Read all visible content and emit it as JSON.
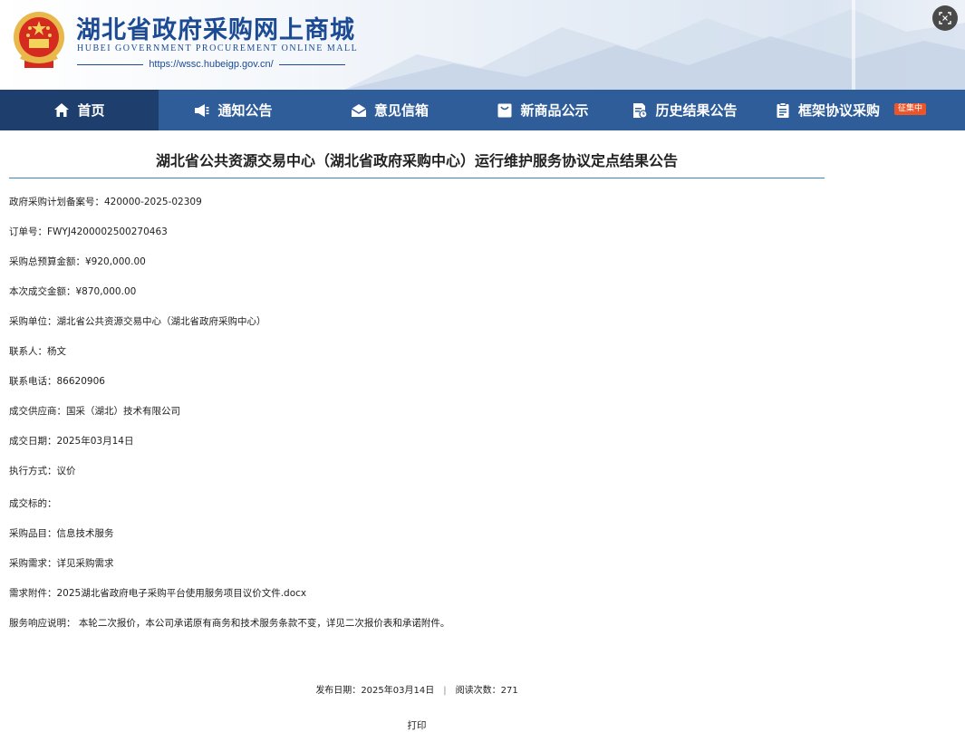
{
  "header": {
    "site_title": "湖北省政府采购网上商城",
    "site_subtitle": "HUBEI GOVERNMENT PROCUREMENT ONLINE MALL",
    "site_url": "https://wssc.hubeigp.gov.cn/"
  },
  "nav": {
    "items": [
      {
        "label": "首页",
        "icon": "home-icon",
        "active": true
      },
      {
        "label": "通知公告",
        "icon": "megaphone-icon"
      },
      {
        "label": "意见信箱",
        "icon": "mailbox-icon"
      },
      {
        "label": "新商品公示",
        "icon": "shopping-bag-icon"
      },
      {
        "label": "历史结果公告",
        "icon": "document-history-icon"
      },
      {
        "label": "框架协议采购",
        "icon": "clipboard-icon",
        "badge": "征集中"
      }
    ]
  },
  "article": {
    "title": "湖北省公共资源交易中心（湖北省政府采购中心）运行维护服务协议定点结果公告",
    "fields": [
      {
        "label": "政府采购计划备案号：",
        "value": "420000-2025-02309"
      },
      {
        "label": "订单号：",
        "value": "FWYJ4200002500270463"
      },
      {
        "label": "采购总预算金额：",
        "value": "¥920,000.00"
      },
      {
        "label": "本次成交金额：",
        "value": "¥870,000.00"
      },
      {
        "label": "采购单位：",
        "value": "湖北省公共资源交易中心（湖北省政府采购中心）"
      },
      {
        "label": "联系人：",
        "value": "杨文"
      },
      {
        "label": "联系电话：",
        "value": "86620906"
      },
      {
        "label": "成交供应商：",
        "value": "国采（湖北）技术有限公司"
      },
      {
        "label": "成交日期：",
        "value": "2025年03月14日"
      },
      {
        "label": "执行方式：",
        "value": "议价"
      },
      {
        "label": "成交标的：",
        "value": ""
      },
      {
        "label": "采购品目：",
        "value": "信息技术服务"
      },
      {
        "label": "采购需求：",
        "value": "详见采购需求"
      },
      {
        "label": "需求附件：",
        "value": "2025湖北省政府电子采购平台使用服务项目议价文件.docx"
      },
      {
        "label": "服务响应说明：",
        "value": " 本轮二次报价，本公司承诺原有商务和技术服务条款不变，详见二次报价表和承诺附件。"
      }
    ]
  },
  "footer": {
    "publish_label": "发布日期：",
    "publish_date": "2025年03月14日",
    "separator": "|",
    "views_label": "阅读次数：",
    "views": "271",
    "print_label": "打印"
  },
  "colors": {
    "nav_bg": "#2f5d99",
    "nav_active_bg": "#1e3f6d",
    "title_blue": "#1c4b94",
    "badge": "#e9562b",
    "rule": "#3a86c4"
  }
}
